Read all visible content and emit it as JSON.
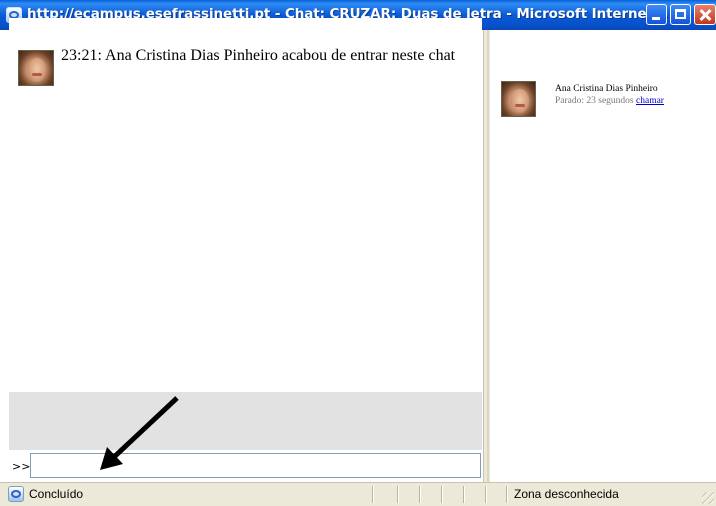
{
  "window": {
    "title": "http://ecampus.esefrassinetti.pt - Chat: CRUZAR: Duas de letra - Microsoft Internet...",
    "icon": "ie-page-icon",
    "controls": [
      "minimize-icon",
      "maximize-icon",
      "close-icon"
    ]
  },
  "chat": {
    "messages": [
      {
        "text": "23:21: Ana Cristina Dias Pinheiro acabou de entrar neste chat",
        "avatar": "user-photo"
      }
    ],
    "input": {
      "prompt": ">>",
      "value": "",
      "placeholder": ""
    }
  },
  "users": [
    {
      "name": "Ana Cristina Dias Pinheiro",
      "status_prefix": "Parado: 23 segundos",
      "action_label": "chamar"
    }
  ],
  "statusbar": {
    "text": "Concluído",
    "zone": "Zona desconhecida"
  },
  "colors": {
    "titlebar": "#0a5fd8",
    "link": "#0000cc",
    "input_strip": "#e2e2e2"
  }
}
